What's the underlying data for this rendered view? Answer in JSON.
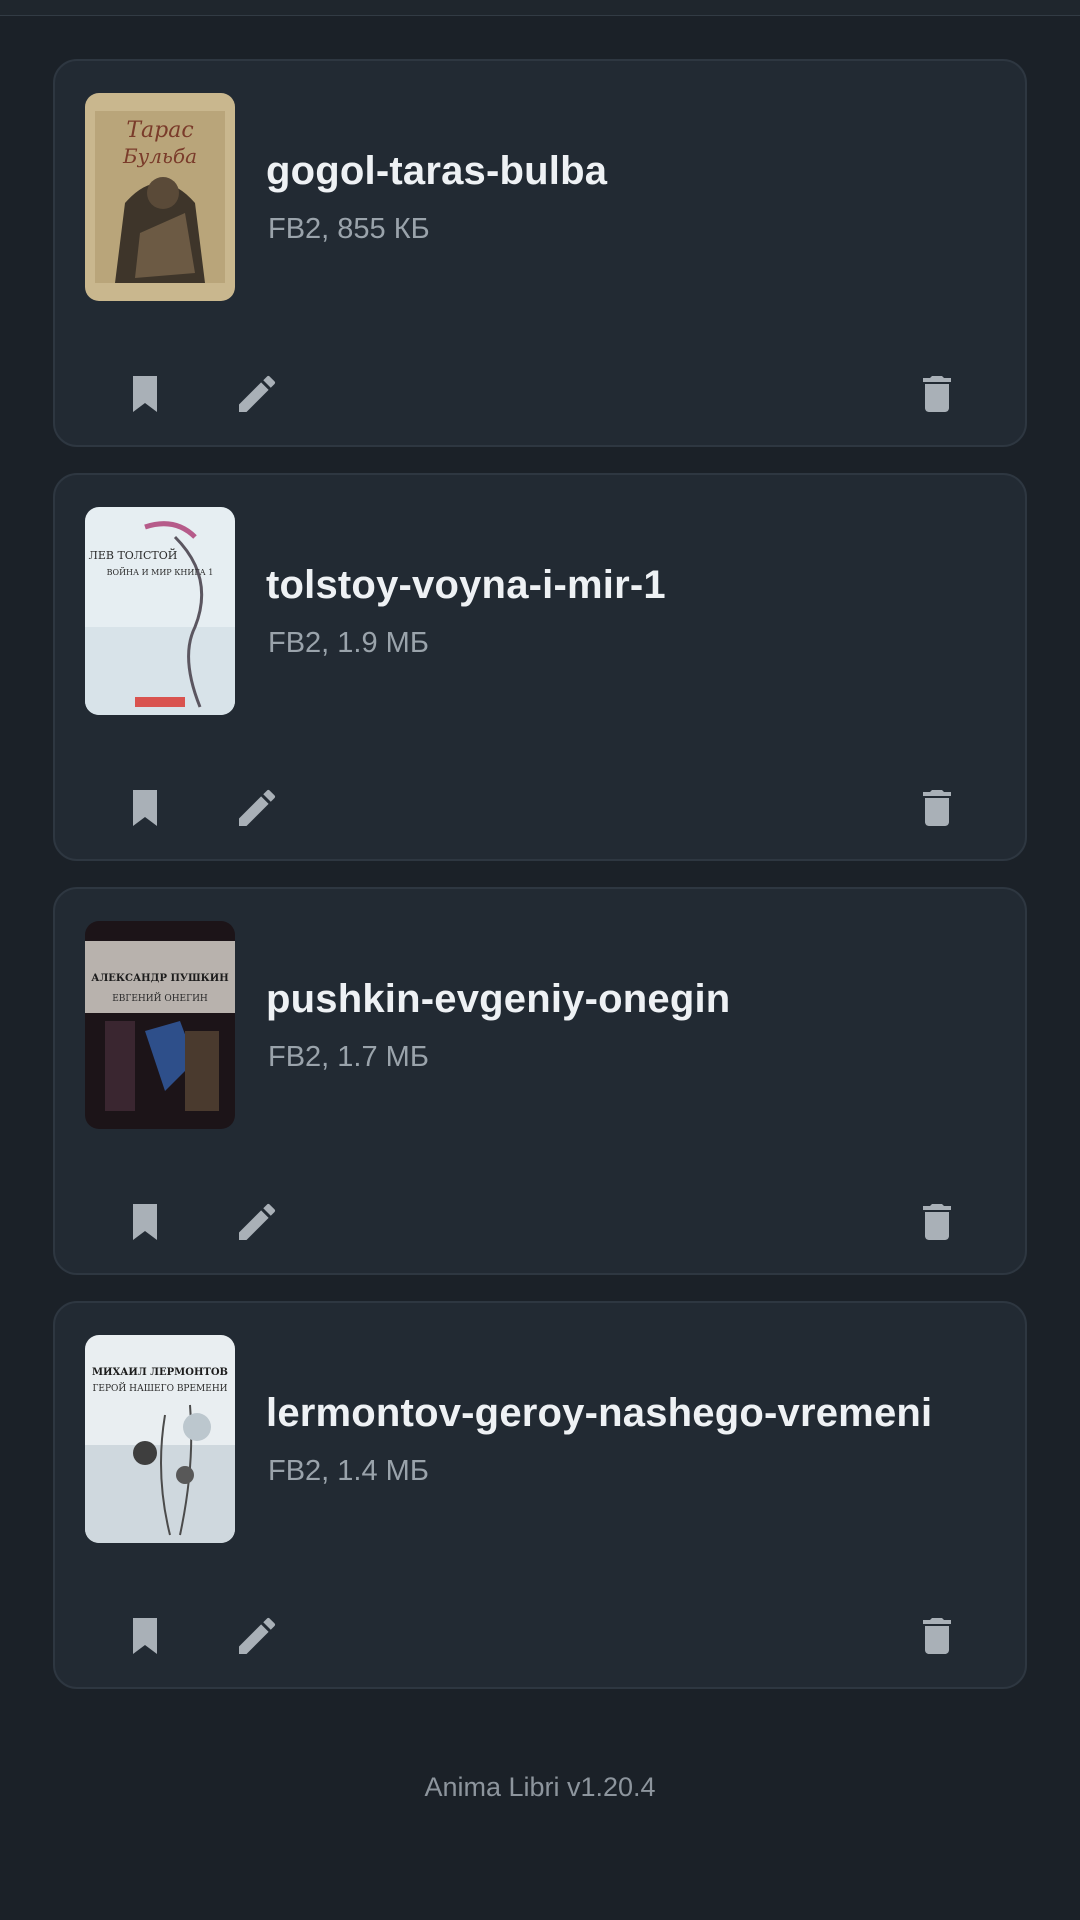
{
  "books": [
    {
      "name": "gogol-taras-bulba",
      "meta": "FB2, 855 КБ",
      "cover_text": [
        "Тарас",
        "Бульба"
      ]
    },
    {
      "name": "tolstoy-voyna-i-mir-1",
      "meta": "FB2, 1.9 МБ",
      "cover_text": [
        "ЛЕВ ТОЛСТОЙ",
        "ВОЙНА И МИР КНИГА 1"
      ]
    },
    {
      "name": "pushkin-evgeniy-onegin",
      "meta": "FB2, 1.7 МБ",
      "cover_text": [
        "АЛЕКСАНДР ПУШКИН",
        "ЕВГЕНИЙ ОНЕГИН"
      ]
    },
    {
      "name": "lermontov-geroy-nashego-vremeni",
      "meta": "FB2, 1.4 МБ",
      "cover_text": [
        "МИХАИЛ ЛЕРМОНТОВ",
        "ГЕРОЙ НАШЕГО ВРЕМЕНИ"
      ]
    }
  ],
  "icons": {
    "bookmark": "bookmark-icon",
    "edit": "pencil-icon",
    "delete": "trash-icon"
  },
  "colors": {
    "background": "#1b2128",
    "card": "#222a33",
    "icon": "#a9b0b7",
    "title": "#eef1f4"
  },
  "footer": {
    "version": "Anima Libri v1.20.4"
  }
}
